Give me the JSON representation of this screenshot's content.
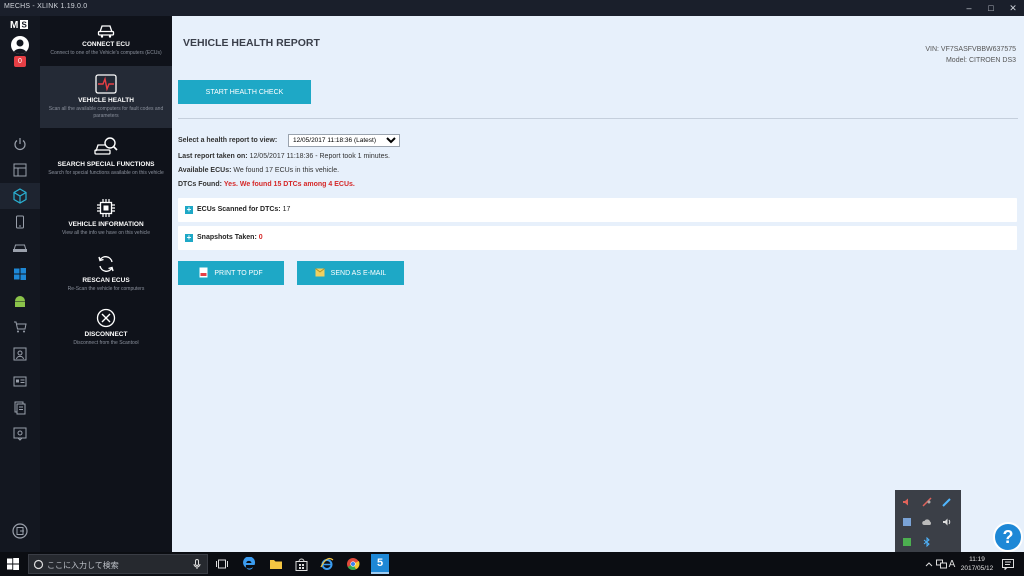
{
  "window": {
    "title": "MECHS - XLINK 1.19.0.0"
  },
  "rail": {
    "logo": "MS",
    "badge": "0"
  },
  "menu": {
    "items": [
      {
        "title": "CONNECT ECU",
        "desc": "Connect to one of the Vehicle's computers (ECUs)",
        "icon": "car-link-icon"
      },
      {
        "title": "VEHICLE HEALTH",
        "desc": "Scan all the available computers for fault codes and parameters",
        "icon": "heart-monitor-icon"
      },
      {
        "title": "SEARCH SPECIAL FUNCTIONS",
        "desc": "Search for special functions available on this vehicle",
        "icon": "car-search-icon"
      },
      {
        "title": "VEHICLE INFORMATION",
        "desc": "View all the info we have on this vehicle",
        "icon": "chip-icon"
      },
      {
        "title": "RESCAN ECUS",
        "desc": "Re-Scan the vehicle for computers",
        "icon": "refresh-icon"
      },
      {
        "title": "DISCONNECT",
        "desc": "Disconnect from the Scantool",
        "icon": "disconnect-icon"
      }
    ]
  },
  "main": {
    "title": "VEHICLE HEALTH REPORT",
    "vin_label": "VIN:",
    "vin": "VF7SASFVBBW637575",
    "model_label": "Model:",
    "model": "CITROEN DS3",
    "start_button": "START HEALTH CHECK",
    "select_label": "Select a health report to view:",
    "select_value": "12/05/2017 11:18:36 (Latest)",
    "last_report_label": "Last report taken on:",
    "last_report_value": "12/05/2017 11:18:36 - Report took 1 minutes.",
    "available_label": "Available ECUs:",
    "available_value": "We found 17 ECUs in this vehicle.",
    "dtcs_label": "DTCs Found:",
    "dtcs_value": "Yes. We found 15 DTCs among 4 ECUs.",
    "scanned_label": "ECUs Scanned for DTCs:",
    "scanned_value": "17",
    "snapshots_label": "Snapshots Taken:",
    "snapshots_value": "0",
    "print_button": "PRINT TO PDF",
    "email_button": "SEND AS E-MAIL"
  },
  "taskbar": {
    "search_placeholder": "ここに入力して検索",
    "time": "11:19",
    "date": "2017/05/12",
    "ime": "A"
  },
  "colors": {
    "accent": "#1ea8c6",
    "danger": "#d52828",
    "main_bg": "#e7f0fb",
    "sidebar_bg": "#0f121a"
  }
}
